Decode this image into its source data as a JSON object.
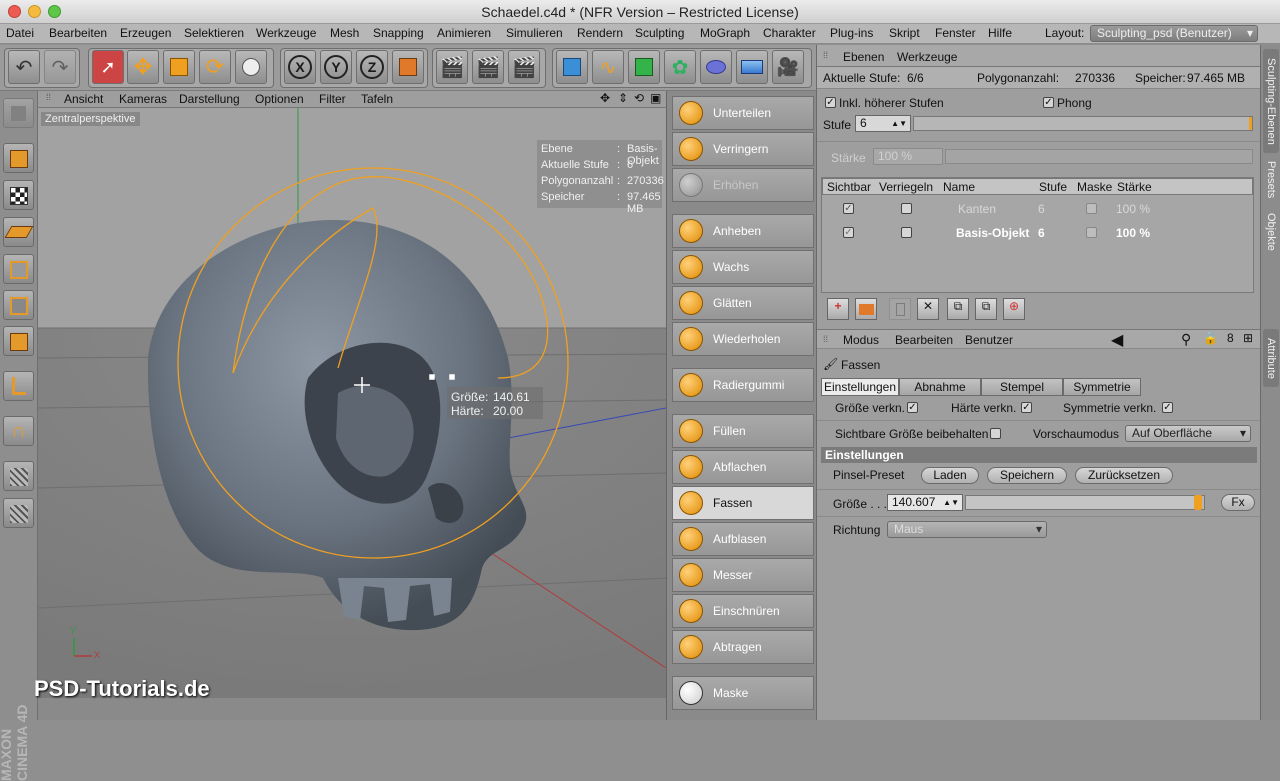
{
  "window": {
    "title": "Schaedel.c4d * (NFR Version – Restricted License)"
  },
  "menu": {
    "items": [
      "Datei",
      "Bearbeiten",
      "Erzeugen",
      "Selektieren",
      "Werkzeuge",
      "Mesh",
      "Snapping",
      "Animieren",
      "Simulieren",
      "Rendern",
      "Sculpting",
      "MoGraph",
      "Charakter",
      "Plug-ins",
      "Skript",
      "Fenster",
      "Hilfe"
    ],
    "layout_label": "Layout:",
    "layout_value": "Sculpting_psd (Benutzer)"
  },
  "toolbar": {
    "axis_x": "X",
    "axis_y": "Y",
    "axis_z": "Z"
  },
  "viewport": {
    "menu": [
      "Ansicht",
      "Kameras",
      "Darstellung",
      "Optionen",
      "Filter",
      "Tafeln"
    ],
    "camera_label": "Zentralperspektive",
    "hud": [
      {
        "key": "Ebene",
        "value": "Basis-Objekt"
      },
      {
        "key": "Aktuelle Stufe",
        "value": "6"
      },
      {
        "key": "Polygonanzahl",
        "value": "270336"
      },
      {
        "key": "Speicher",
        "value": "97.465 MB"
      }
    ],
    "brush_tip": {
      "size_label": "Größe:",
      "size_value": "140.61",
      "hardness_label": "Härte:",
      "hardness_value": "20.00"
    },
    "axis_y_label": "Y",
    "axis_x_label": "X",
    "watermark": "PSD-Tutorials.de",
    "maxon_logo": "MAXON CINEMA 4D"
  },
  "brushes": [
    {
      "label": "Unterteilen",
      "state": "normal"
    },
    {
      "label": "Verringern",
      "state": "normal"
    },
    {
      "label": "Erhöhen",
      "state": "dim"
    },
    {
      "label": "Anheben",
      "state": "normal"
    },
    {
      "label": "Wachs",
      "state": "normal"
    },
    {
      "label": "Glätten",
      "state": "normal"
    },
    {
      "label": "Wiederholen",
      "state": "normal"
    },
    {
      "label": "Radiergummi",
      "state": "normal"
    },
    {
      "label": "Füllen",
      "state": "normal"
    },
    {
      "label": "Abflachen",
      "state": "normal"
    },
    {
      "label": "Fassen",
      "state": "active"
    },
    {
      "label": "Aufblasen",
      "state": "normal"
    },
    {
      "label": "Messer",
      "state": "normal"
    },
    {
      "label": "Einschnüren",
      "state": "normal"
    },
    {
      "label": "Abtragen",
      "state": "normal"
    },
    {
      "label": "Maske",
      "state": "normal"
    }
  ],
  "layers": {
    "tabs": [
      "Ebenen",
      "Werkzeuge"
    ],
    "current_level_label": "Aktuelle Stufe:",
    "current_level_value": "6/6",
    "poly_label": "Polygonanzahl:",
    "poly_value": "270336",
    "memory_label": "Speicher:",
    "memory_value": "97.465 MB",
    "include_higher": "Inkl. höherer Stufen",
    "phong": "Phong",
    "level_label": "Stufe",
    "level_value": "6",
    "strength_label": "Stärke",
    "strength_value": "100 %",
    "columns": [
      "Sichtbar",
      "Verriegeln",
      "Name",
      "Stufe",
      "Maske",
      "Stärke"
    ],
    "rows": [
      {
        "name": "Kanten",
        "level": "6",
        "strength": "100 %",
        "dim": true
      },
      {
        "name": "Basis-Objekt",
        "level": "6",
        "strength": "100 %",
        "dim": false
      }
    ]
  },
  "attributes": {
    "menu": [
      "Modus",
      "Bearbeiten",
      "Benutzer"
    ],
    "tool_name": "Fassen",
    "tabs": [
      "Einstellungen",
      "Abnahme",
      "Stempel",
      "Symmetrie"
    ],
    "link_size": "Größe verkn.",
    "link_hardness": "Härte verkn.",
    "link_symmetry": "Symmetrie verkn.",
    "keep_visible_size": "Sichtbare Größe beibehalten",
    "preview_mode_label": "Vorschaumodus",
    "preview_mode_value": "Auf Oberfläche",
    "section_title": "Einstellungen",
    "preset_label": "Pinsel-Preset",
    "btn_load": "Laden",
    "btn_save": "Speichern",
    "btn_reset": "Zurücksetzen",
    "size_label": "Größe . . .",
    "size_value": "140.607",
    "size_fraction": 0.99,
    "fx_label": "Fx",
    "direction_label": "Richtung",
    "direction_value": "Maus"
  },
  "side_tabs": [
    "Sculpting-Ebenen",
    "Presets",
    "Objekte",
    "Attribute"
  ],
  "colors": {
    "accent_orange": "#f0a020",
    "viewport_bg": "#a2a2a2",
    "skull": "#6f7985"
  }
}
